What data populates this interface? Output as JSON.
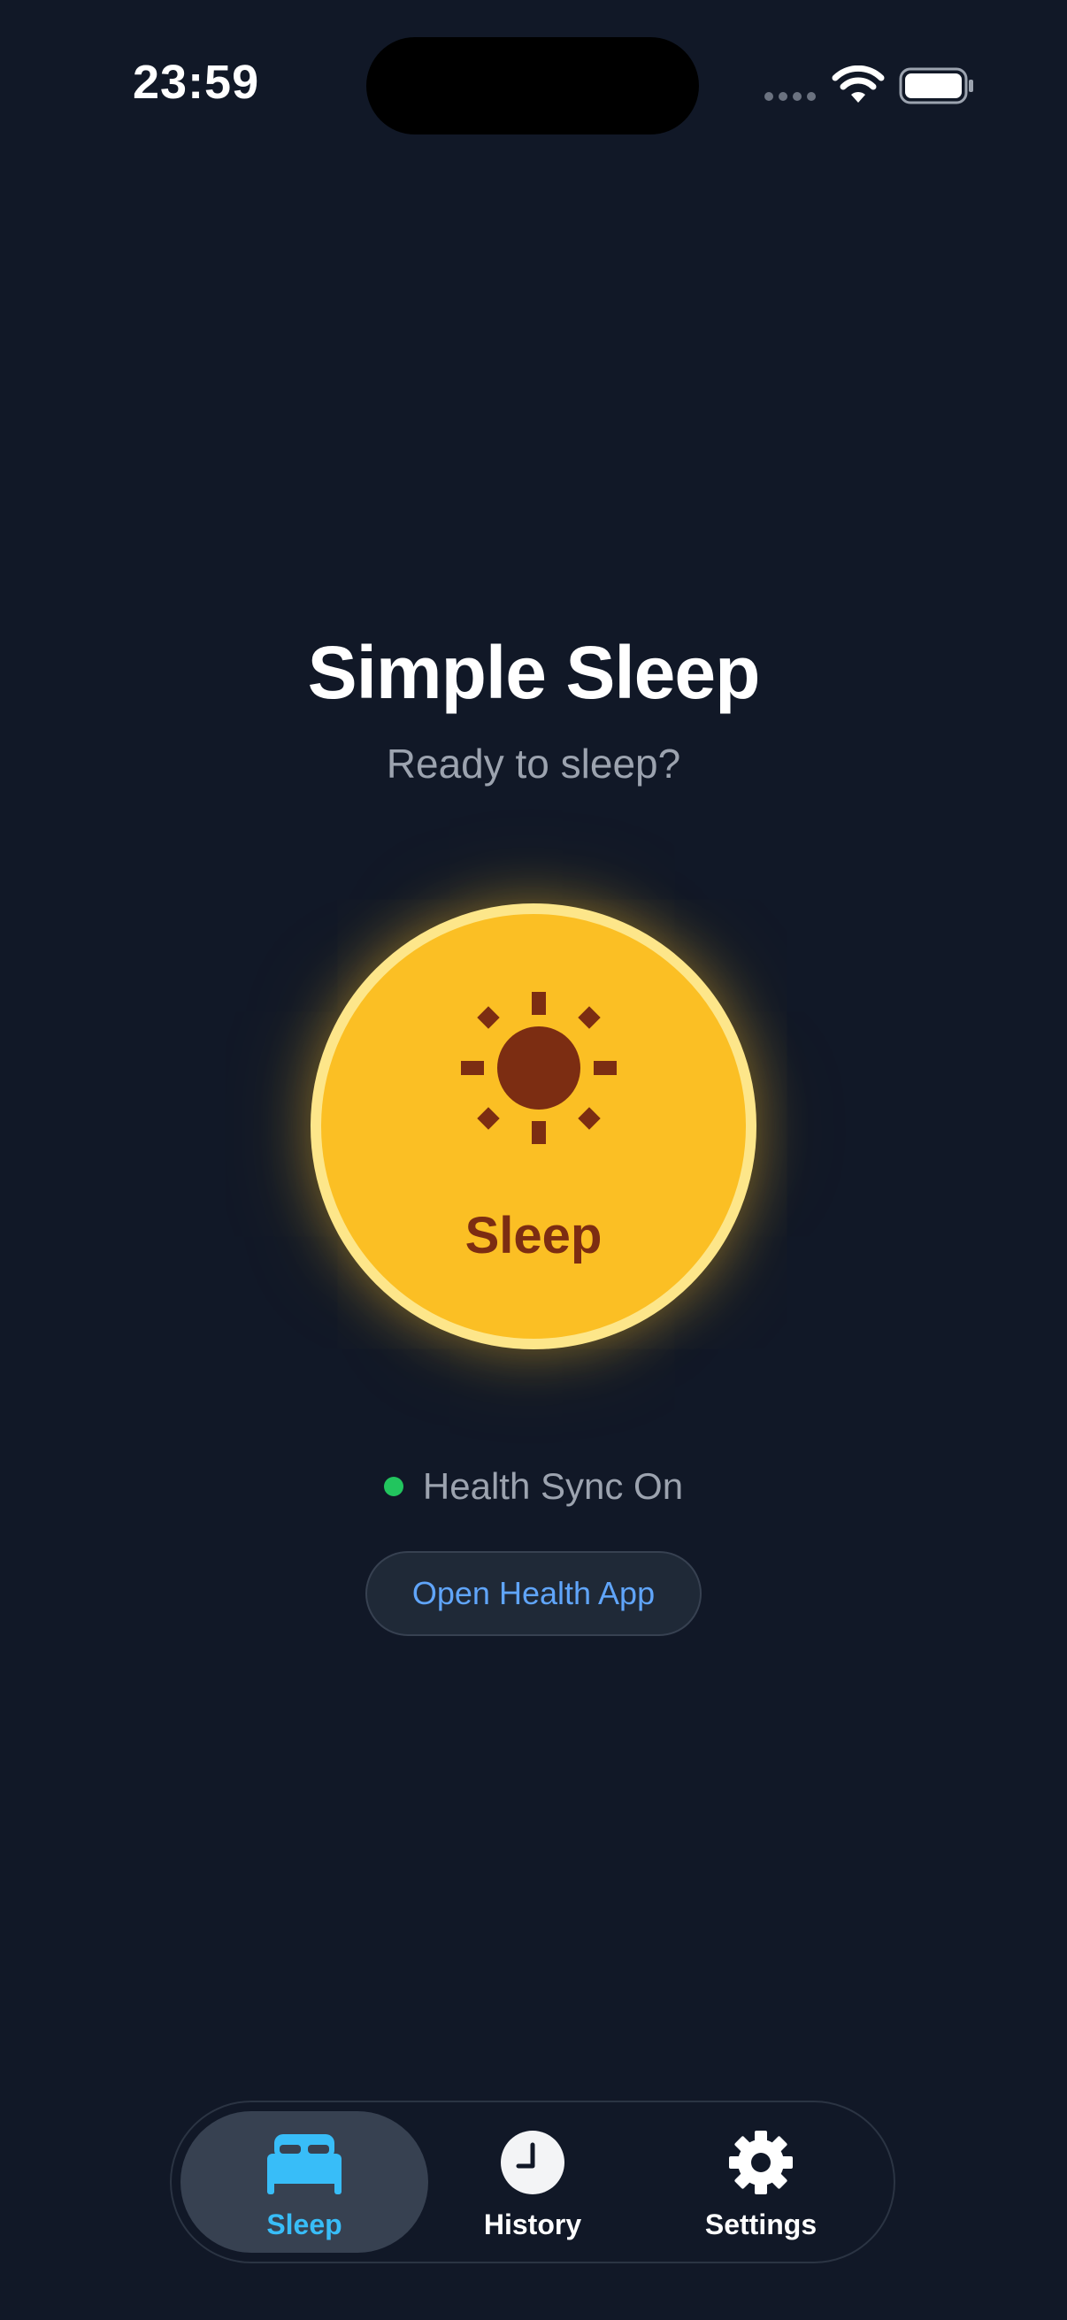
{
  "status_bar": {
    "time": "23:59",
    "wifi_icon": "wifi-icon",
    "battery_icon": "battery-icon"
  },
  "main": {
    "title": "Simple Sleep",
    "subtitle": "Ready to sleep?",
    "sleep_button": {
      "label": "Sleep",
      "icon": "sun-icon",
      "color": "#fbbf24"
    },
    "sync_status": {
      "text": "Health Sync On",
      "indicator_color": "#22c55e"
    },
    "open_health_button": {
      "label": "Open Health App"
    }
  },
  "tab_bar": {
    "active": "Sleep",
    "accent_color": "#38bdf8",
    "tabs": [
      {
        "label": "Sleep",
        "icon": "bed-icon"
      },
      {
        "label": "History",
        "icon": "clock-icon"
      },
      {
        "label": "Settings",
        "icon": "gear-icon"
      }
    ]
  }
}
